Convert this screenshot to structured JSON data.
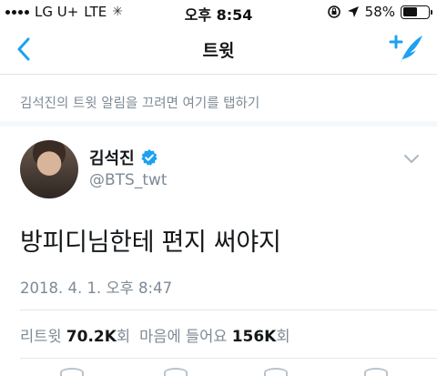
{
  "status_bar": {
    "carrier": "LG U+",
    "network": "LTE",
    "time": "오후 8:54",
    "battery_text": "58%",
    "battery_level": 0.58,
    "icons": [
      "signal-dots-icon",
      "loading-spinner-icon",
      "orientation-lock-icon",
      "location-arrow-icon",
      "battery-icon"
    ]
  },
  "nav": {
    "title": "트윗",
    "back_icon": "chevron-left-icon",
    "compose_icon": "compose-tweet-icon"
  },
  "notification_hint": "김석진의 트윗 알림을 끄려면 여기를 탭하기",
  "tweet": {
    "author_name": "김석진",
    "verified": true,
    "handle": "@BTS_twt",
    "text": "방피디님한테 편지 써야지",
    "timestamp": "2018. 4. 1. 오후 8:47",
    "stats": {
      "retweet_label": "리트윗",
      "retweet_count": "70.2K",
      "retweet_unit": "회",
      "like_label": "마음에 들어요",
      "like_count": "156K",
      "like_unit": "회"
    }
  },
  "colors": {
    "accent": "#1da1f2",
    "secondary_text": "#7d8a96",
    "primary_text": "#14171a",
    "divider": "#e1e8ed"
  }
}
